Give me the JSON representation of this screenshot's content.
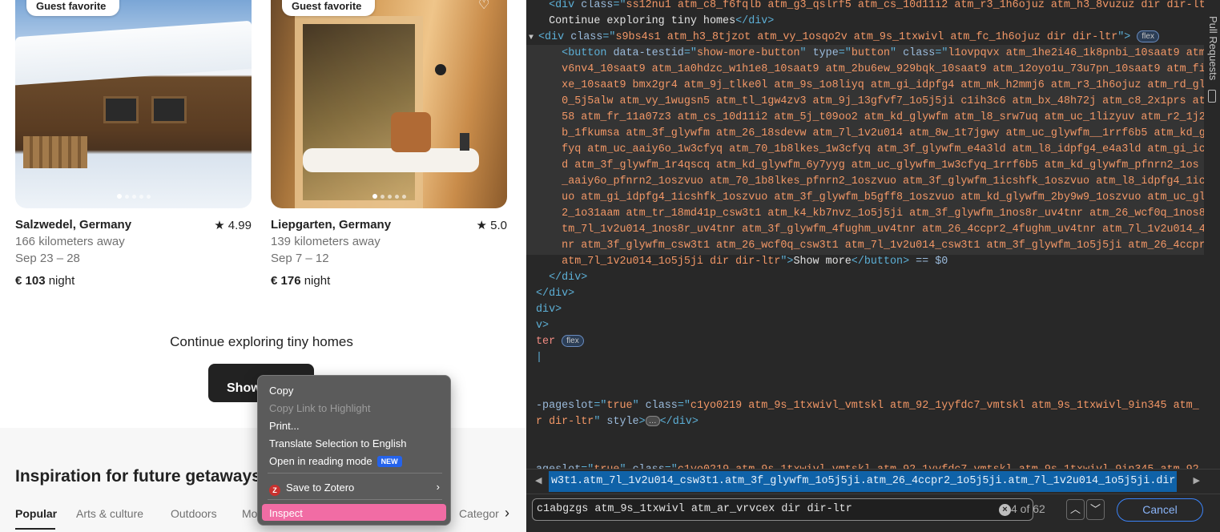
{
  "listings": [
    {
      "badge": "Guest favorite",
      "title": "Salzwedel, Germany",
      "rating": "★ 4.99",
      "distance": "166 kilometers away",
      "dates": "Sep 23 – 28",
      "price": "€ 103",
      "price_unit": " night"
    },
    {
      "badge": "Guest favorite",
      "title": "Liepgarten, Germany",
      "rating": "★ 5.0",
      "distance": "139 kilometers away",
      "dates": "Sep 7 – 12",
      "price": "€ 176",
      "price_unit": " night"
    }
  ],
  "section": {
    "title": "Continue exploring tiny homes",
    "button": "Show more"
  },
  "inspiration": {
    "title": "Inspiration for future getaways",
    "tabs": [
      "Popular",
      "Arts & culture",
      "Outdoors",
      "Mo",
      "Categor"
    ]
  },
  "context_menu": {
    "items": [
      {
        "label": "Copy",
        "disabled": false
      },
      {
        "label": "Copy Link to Highlight",
        "disabled": true
      },
      {
        "label": "Print...",
        "disabled": false
      },
      {
        "label": "Translate Selection to English",
        "disabled": false
      },
      {
        "label": "Open in reading mode",
        "disabled": false,
        "badge": "NEW"
      },
      {
        "label": "Save to Zotero",
        "disabled": false,
        "submenu": true
      },
      {
        "label": "Inspect",
        "disabled": false,
        "highlighted": true
      }
    ]
  },
  "devtools": {
    "lines": [
      {
        "indent": "  ",
        "parts": [
          [
            "t",
            "<div "
          ],
          [
            "a",
            "class"
          ],
          [
            "t",
            "=\""
          ],
          [
            "v",
            "ss12nu1 atm_c8_f6fqlb atm_g3_qslrf5 atm_cs_10d11i2 atm_r3_1h6ojuz atm_h3_8vuzuz dir dir-ltr"
          ],
          [
            "t",
            "\">"
          ]
        ]
      },
      {
        "indent": "  ",
        "parts": [
          [
            "tx",
            "Continue exploring tiny homes"
          ],
          [
            "t",
            "</div>"
          ]
        ]
      },
      {
        "indent": "",
        "tri": "▼",
        "parts": [
          [
            "t",
            "<div "
          ],
          [
            "a",
            "class"
          ],
          [
            "t",
            "=\""
          ],
          [
            "v",
            "s9bs4s1 atm_h3_8tjzot atm_vy_1osqo2v atm_9s_1txwivl atm_fc_1h6ojuz dir dir-ltr"
          ],
          [
            "t",
            "\">"
          ]
        ],
        "badge": "flex"
      },
      {
        "indent": "    ",
        "parts": [
          [
            "t",
            "<button "
          ],
          [
            "a",
            "data-testid"
          ],
          [
            "t",
            "=\""
          ],
          [
            "v",
            "show-more-button"
          ],
          [
            "t",
            "\" "
          ],
          [
            "a",
            "type"
          ],
          [
            "t",
            "=\""
          ],
          [
            "v",
            "button"
          ],
          [
            "t",
            "\" "
          ],
          [
            "a",
            "class"
          ],
          [
            "t",
            "=\""
          ],
          [
            "v",
            "l1ovpqvx atm_1he2i46_1k8pnbi_10saat9 atm_y"
          ]
        ]
      },
      {
        "indent": "    ",
        "parts": [
          [
            "v",
            "v6nv4_10saat9 atm_1a0hdzc_w1h1e8_10saat9 atm_2bu6ew_929bqk_10saat9 atm_12oyo1u_73u7pn_10saat9 atm_fi"
          ]
        ]
      },
      {
        "indent": "    ",
        "parts": [
          [
            "v",
            "xe_10saat9 bmx2gr4 atm_9j_tlke0l atm_9s_1o8liyq atm_gi_idpfg4 atm_mk_h2mmj6 atm_r3_1h6ojuz atm_rd_gl"
          ]
        ]
      },
      {
        "indent": "    ",
        "parts": [
          [
            "v",
            "0_5j5alw atm_vy_1wugsn5 atm_tl_1gw4zv3 atm_9j_13gfvf7_1o5j5ji c1ih3c6 atm_bx_48h72j atm_c8_2x1prs at"
          ]
        ]
      },
      {
        "indent": "    ",
        "parts": [
          [
            "v",
            "58 atm_fr_11a07z3 atm_cs_10d11i2 atm_5j_t09oo2 atm_kd_glywfm atm_l8_srw7uq atm_uc_1lizyuv atm_r2_1j2"
          ]
        ]
      },
      {
        "indent": "    ",
        "parts": [
          [
            "v",
            "b_1fkumsa atm_3f_glywfm atm_26_18sdevw atm_7l_1v2u014 atm_8w_1t7jgwy atm_uc_glywfm__1rrf6b5 atm_kd_g"
          ]
        ]
      },
      {
        "indent": "    ",
        "parts": [
          [
            "v",
            "fyq atm_uc_aaiy6o_1w3cfyq atm_70_1b8lkes_1w3cfyq atm_3f_glywfm_e4a3ld atm_l8_idpfg4_e4a3ld atm_gi_ic"
          ]
        ]
      },
      {
        "indent": "    ",
        "parts": [
          [
            "v",
            "d atm_3f_glywfm_1r4qscq atm_kd_glywfm_6y7yyg atm_uc_glywfm_1w3cfyq_1rrf6b5 atm_kd_glywfm_pfnrn2_1os"
          ]
        ]
      },
      {
        "indent": "    ",
        "parts": [
          [
            "v",
            "_aaiy6o_pfnrn2_1oszvuo atm_70_1b8lkes_pfnrn2_1oszvuo atm_3f_glywfm_1icshfk_1oszvuo atm_l8_idpfg4_1ic"
          ]
        ]
      },
      {
        "indent": "    ",
        "parts": [
          [
            "v",
            "uo atm_gi_idpfg4_1icshfk_1oszvuo atm_3f_glywfm_b5gff8_1oszvuo atm_kd_glywfm_2by9w9_1oszvuo atm_uc_gl"
          ]
        ]
      },
      {
        "indent": "    ",
        "parts": [
          [
            "v",
            "2_1o31aam atm_tr_18md41p_csw3t1 atm_k4_kb7nvz_1o5j5ji atm_3f_glywfm_1nos8r_uv4tnr atm_26_wcf0q_1nos8"
          ]
        ]
      },
      {
        "indent": "    ",
        "parts": [
          [
            "v",
            "tm_7l_1v2u014_1nos8r_uv4tnr atm_3f_glywfm_4fughm_uv4tnr atm_26_4ccpr2_4fughm_uv4tnr atm_7l_1v2u014_4"
          ]
        ]
      },
      {
        "indent": "    ",
        "parts": [
          [
            "v",
            "nr atm_3f_glywfm_csw3t1 atm_26_wcf0q_csw3t1 atm_7l_1v2u014_csw3t1 atm_3f_glywfm_1o5j5ji atm_26_4ccpr"
          ]
        ]
      },
      {
        "indent": "    ",
        "parts": [
          [
            "v",
            "atm_7l_1v2u014_1o5j5ji dir dir-ltr"
          ],
          [
            "t",
            "\">"
          ],
          [
            "tx",
            "Show more"
          ],
          [
            "t",
            "</button>"
          ],
          [
            "a",
            " == $0"
          ]
        ]
      },
      {
        "indent": "  ",
        "parts": [
          [
            "t",
            "</div>"
          ]
        ]
      },
      {
        "indent": "",
        "parts": [
          [
            "t",
            "</div>"
          ]
        ]
      },
      {
        "indent": "",
        "parts": [
          [
            "t",
            "div>"
          ]
        ]
      },
      {
        "indent": "",
        "parts": [
          [
            "t",
            "v>"
          ]
        ]
      },
      {
        "indent": "",
        "parts": [
          [
            "pn",
            "ter"
          ]
        ],
        "badge": "flex"
      },
      {
        "indent": "",
        "parts": [
          [
            "t",
            "|"
          ]
        ]
      },
      {
        "indent": "",
        "parts": []
      },
      {
        "indent": "",
        "parts": []
      },
      {
        "indent": "",
        "parts": [
          [
            "a",
            "-pageslot"
          ],
          [
            "t",
            "=\""
          ],
          [
            "v",
            "true"
          ],
          [
            "t",
            "\" "
          ],
          [
            "a",
            "class"
          ],
          [
            "t",
            "=\""
          ],
          [
            "v",
            "c1yo0219 atm_9s_1txwivl_vmtskl atm_92_1yyfdc7_vmtskl atm_9s_1txwivl_9in345 atm_"
          ]
        ]
      },
      {
        "indent": "",
        "parts": [
          [
            "v",
            "r dir-ltr"
          ],
          [
            "t",
            "\" "
          ],
          [
            "a",
            "style"
          ],
          [
            "t",
            ">"
          ]
        ],
        "ellip": true,
        "after": "</div>"
      },
      {
        "indent": "",
        "parts": []
      },
      {
        "indent": "",
        "parts": []
      },
      {
        "indent": "",
        "parts": [
          [
            "a",
            "ageslot"
          ],
          [
            "t",
            "=\""
          ],
          [
            "v",
            "true"
          ],
          [
            "t",
            "\" "
          ],
          [
            "a",
            "class"
          ],
          [
            "t",
            "=\""
          ],
          [
            "v",
            "c1yo0219 atm_9s_1txwivl_vmtskl atm_92_1yyfdc7_vmtskl atm_9s_1txwivl_9in345 atm_92"
          ]
        ]
      }
    ],
    "breadcrumb": "w3t1.atm_7l_1v2u014_csw3t1.atm_3f_glywfm_1o5j5ji.atm_26_4ccpr2_1o5j5ji.atm_7l_1v2u014_1o5j5ji.dir.dir-ltr",
    "search_value": "c1abgzgs atm_9s_1txwivl atm_ar_vrvcex dir dir-ltr",
    "match_count": "4 of 62",
    "cancel_label": "Cancel",
    "side_label": "Pull Requests"
  }
}
